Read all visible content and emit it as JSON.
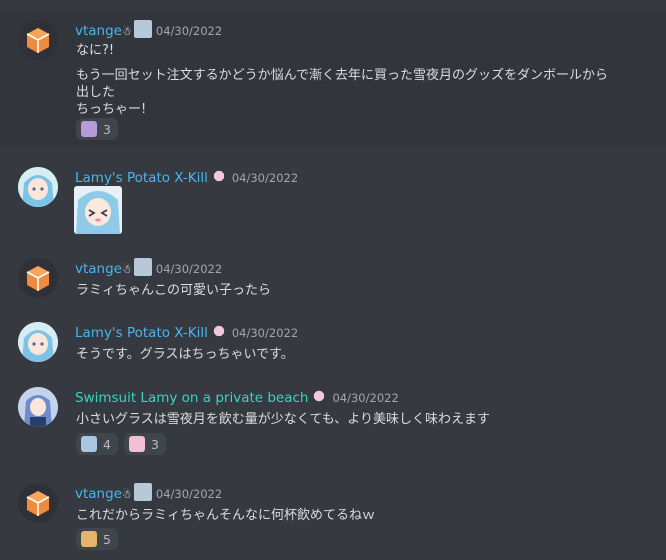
{
  "messages": [
    {
      "author": "vtange",
      "author_badge": "☃",
      "timestamp": "04/30/2022",
      "lines": [
        "なに?!",
        "もう一回セット注文するかどうか悩んで漸く去年に買った雪夜月のグッズをダンボールから",
        "出した",
        "ちっちゃー!"
      ],
      "reactions": [
        {
          "icon": "sticker-emoji",
          "count": "3"
        }
      ]
    },
    {
      "author": "Lamy's Potato X-Kill",
      "timestamp": "04/30/2022",
      "lines": [],
      "image": "lamy-emote"
    },
    {
      "author": "vtange",
      "author_badge": "☃",
      "timestamp": "04/30/2022",
      "lines": [
        "ラミィちゃんこの可愛い子ったら"
      ]
    },
    {
      "author": "Lamy's Potato X-Kill",
      "timestamp": "04/30/2022",
      "lines": [
        "そうです。グラスはちっちゃいです。"
      ]
    },
    {
      "author": "Swimsuit Lamy on a private beach",
      "timestamp": "04/30/2022",
      "lines": [
        "小さいグラスは雪夜月を飲む量が少なくても、より美味しく味わえます"
      ],
      "reactions": [
        {
          "icon": "lamy-emoji",
          "count": "4"
        },
        {
          "icon": "heart-emoji",
          "count": "3"
        }
      ]
    },
    {
      "author": "vtange",
      "author_badge": "☃",
      "timestamp": "04/30/2022",
      "lines": [
        "これだからラミィちゃんそんなに何杯飲めてるねｗ"
      ],
      "reactions": [
        {
          "icon": "party-emoji",
          "count": "5"
        }
      ]
    }
  ],
  "colors": {
    "background": "#36393f",
    "name_blue": "#48b6f0",
    "name_teal": "#2fd8c5",
    "reaction_bg": "#40444b"
  }
}
